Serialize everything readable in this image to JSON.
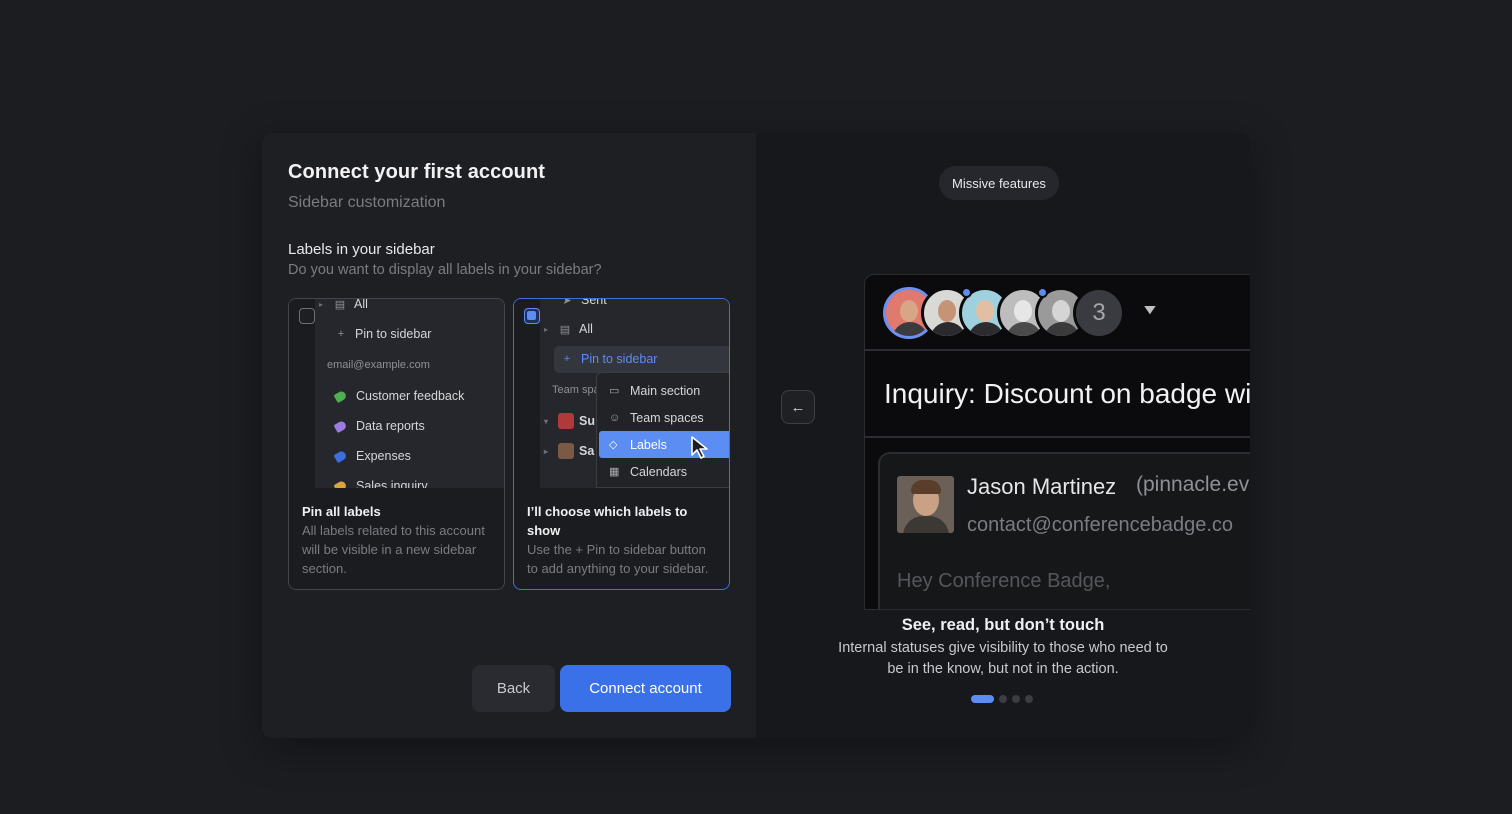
{
  "left": {
    "title": "Connect your first account",
    "subtitle": "Sidebar customization",
    "section_title": "Labels in your sidebar",
    "section_subtitle": "Do you want to display all labels in your sidebar?",
    "option_pin_all": {
      "preview": {
        "all": "All",
        "pin": "Pin to sidebar",
        "account": "email@example.com",
        "labels": [
          {
            "name": "Customer feedback",
            "color": "#4caf50"
          },
          {
            "name": "Data reports",
            "color": "#9b7be0"
          },
          {
            "name": "Expenses",
            "color": "#3b6fe0"
          },
          {
            "name": "Sales inquiry",
            "color": "#d9a43a"
          }
        ]
      },
      "title": "Pin all labels",
      "description": "All labels related to this account will be visible in a new sidebar section."
    },
    "option_choose": {
      "preview": {
        "sent": "Sent",
        "all": "All",
        "pin": "Pin to sidebar",
        "team_spaces": "Team spa",
        "item1": "Su",
        "item2": "Sa",
        "menu": [
          "Main section",
          "Team spaces",
          "Labels",
          "Calendars"
        ]
      },
      "title": "I’ll choose which labels to show",
      "description": "Use the + Pin to sidebar button to add anything to your sidebar."
    },
    "back_label": "Back",
    "connect_label": "Connect account"
  },
  "right": {
    "pill": "Missive features",
    "avatar_more": "3",
    "subject": "Inquiry: Discount on badge wit",
    "sender_name": "Jason Martinez",
    "sender_extra": "(pinnacle.ev",
    "sender_email": "contact@conferencebadge.co",
    "greeting": "Hey Conference Badge,",
    "feature_title": "See, read, but don’t touch",
    "feature_description": "Internal statuses give visibility to those who need to be in the know, but not in the action.",
    "pagination": {
      "current": 1,
      "total": 4
    }
  },
  "colors": {
    "accent": "#3b71e8",
    "accent_light": "#5b8df2",
    "background": "#1c1d21"
  }
}
